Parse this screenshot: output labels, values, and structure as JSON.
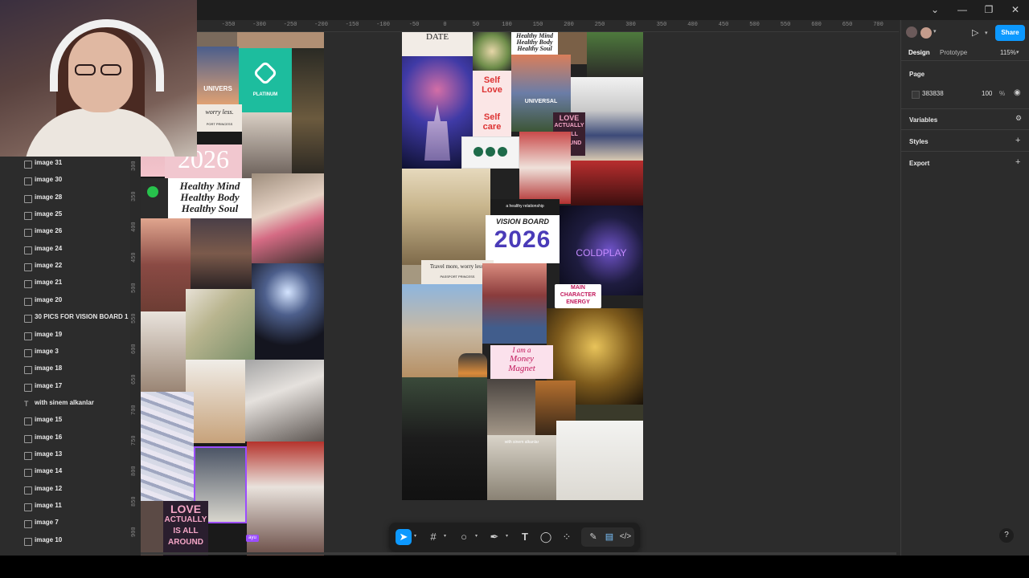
{
  "window": {
    "controls": [
      "⌄",
      "—",
      "❐",
      "✕"
    ]
  },
  "ruler": {
    "top_ticks": [
      "-350",
      "-300",
      "-250",
      "-200",
      "-150",
      "-100",
      "-50",
      "0",
      "50",
      "100",
      "150",
      "200",
      "250",
      "300",
      "350",
      "400",
      "450",
      "500",
      "550",
      "600",
      "650",
      "700"
    ],
    "left_ticks": [
      "300",
      "350",
      "400",
      "450",
      "500",
      "550",
      "600",
      "650",
      "700",
      "750",
      "800",
      "850",
      "900"
    ]
  },
  "layers": [
    {
      "label": "image 31",
      "type": "image"
    },
    {
      "label": "image 30",
      "type": "image"
    },
    {
      "label": "image 28",
      "type": "image"
    },
    {
      "label": "image 25",
      "type": "image"
    },
    {
      "label": "image 26",
      "type": "image"
    },
    {
      "label": "image 24",
      "type": "image"
    },
    {
      "label": "image 22",
      "type": "image"
    },
    {
      "label": "image 21",
      "type": "image"
    },
    {
      "label": "image 20",
      "type": "image"
    },
    {
      "label": "30 PICS FOR VISION BOARD 1",
      "type": "image"
    },
    {
      "label": "image 19",
      "type": "image"
    },
    {
      "label": "image 3",
      "type": "image"
    },
    {
      "label": "image 18",
      "type": "image"
    },
    {
      "label": "image 17",
      "type": "image"
    },
    {
      "label": "with sinem alkanlar",
      "type": "text"
    },
    {
      "label": "image 15",
      "type": "image"
    },
    {
      "label": "image 16",
      "type": "image"
    },
    {
      "label": "image 13",
      "type": "image"
    },
    {
      "label": "image 14",
      "type": "image"
    },
    {
      "label": "image 12",
      "type": "image"
    },
    {
      "label": "image 11",
      "type": "image"
    },
    {
      "label": "image 7",
      "type": "image"
    },
    {
      "label": "image 10",
      "type": "image"
    }
  ],
  "props": {
    "tabs": {
      "design": "Design",
      "prototype": "Prototype"
    },
    "zoom": "115%",
    "share_label": "Share",
    "page": {
      "title": "Page",
      "color": "383838",
      "opacity": "100",
      "percent": "%"
    },
    "variables_label": "Variables",
    "styles_label": "Styles",
    "export_label": "Export"
  },
  "collage_text": {
    "left_2026": "2026",
    "left_worry": "worry less.",
    "left_princess": "PORT PRINCESS",
    "left_platinum": "PLATINUM",
    "left_universal": "UNIVERS",
    "left_healthy": [
      "Healthy Mind",
      "Healthy Body",
      "Healthy Soul"
    ],
    "left_love": [
      "LOVE",
      "ACTUALLY",
      "IS ALL",
      "AROUND"
    ],
    "left_tag": "ayu",
    "main_date": "DATE",
    "main_healthy": [
      "Healthy Mind",
      "Healthy Body",
      "Healthy Soul"
    ],
    "main_self_love": [
      "Self",
      "Love"
    ],
    "main_self_care": [
      "Self",
      "care"
    ],
    "main_universal": "UNIVERSAL",
    "main_love": [
      "LOVE",
      "ACTUALLY",
      "IS ALL",
      "AROUND"
    ],
    "main_relationship": "a healthy relationship",
    "main_vision_board": "VISION BOARD",
    "main_vision_year": "2026",
    "main_coldplay": "COLDPLAY",
    "main_travel": "Travel more, worry less.",
    "main_passport": "PASSPORT PRINCESS",
    "main_character": [
      "MAIN",
      "CHARACTER",
      "ENERGY"
    ],
    "main_money": [
      "I am a",
      "Money",
      "Magnet"
    ],
    "main_caption": "with sinem alkanlar"
  },
  "colors": {
    "accent": "#0d99ff",
    "selection": "#9b4dff",
    "canvas": "#2c2c2c",
    "panel": "#2c2c2c",
    "topbar": "#1e1e1e"
  },
  "icons": {
    "toolbar": [
      "move-icon",
      "frame-icon",
      "shape-icon",
      "pen-icon",
      "text-icon",
      "comment-icon",
      "actions-icon",
      "draw-icon",
      "dev-mode-icon",
      "code-icon"
    ]
  }
}
